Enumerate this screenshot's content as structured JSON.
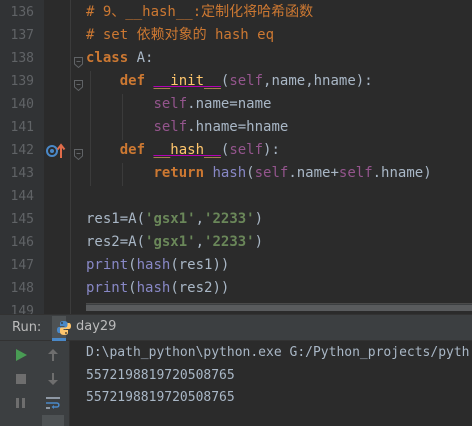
{
  "editor": {
    "lines": [
      {
        "num": "136",
        "tokens": [
          {
            "t": "# 9、__hash__:定制化将哈希函数",
            "c": "cmt"
          }
        ]
      },
      {
        "num": "137",
        "tokens": [
          {
            "t": "# set 依赖对象的 hash eq",
            "c": "cmt"
          }
        ]
      },
      {
        "num": "138",
        "tokens": [
          {
            "t": "class ",
            "c": "kw"
          },
          {
            "t": "A",
            "c": "pl"
          },
          {
            "t": ":",
            "c": "pl"
          }
        ]
      },
      {
        "num": "139",
        "tokens": [
          {
            "t": "    "
          },
          {
            "t": "def ",
            "c": "kw"
          },
          {
            "t": "__init__",
            "c": "dunder"
          },
          {
            "t": "(",
            "c": "pl"
          },
          {
            "t": "self",
            "c": "slf"
          },
          {
            "t": ",",
            "c": "pl"
          },
          {
            "t": "name",
            "c": "prm"
          },
          {
            "t": ",",
            "c": "pl"
          },
          {
            "t": "hname",
            "c": "prm"
          },
          {
            "t": "):",
            "c": "pl"
          }
        ]
      },
      {
        "num": "140",
        "tokens": [
          {
            "t": "        "
          },
          {
            "t": "self",
            "c": "slf"
          },
          {
            "t": ".name=name",
            "c": "pl"
          }
        ]
      },
      {
        "num": "141",
        "tokens": [
          {
            "t": "        "
          },
          {
            "t": "self",
            "c": "slf"
          },
          {
            "t": ".hname=hname",
            "c": "pl"
          }
        ]
      },
      {
        "num": "142",
        "tokens": [
          {
            "t": "    "
          },
          {
            "t": "def ",
            "c": "kw"
          },
          {
            "t": "__hash__",
            "c": "dunder"
          },
          {
            "t": "(",
            "c": "pl"
          },
          {
            "t": "self",
            "c": "slf"
          },
          {
            "t": "):",
            "c": "pl"
          }
        ]
      },
      {
        "num": "143",
        "tokens": [
          {
            "t": "        "
          },
          {
            "t": "return ",
            "c": "kw"
          },
          {
            "t": "hash",
            "c": "bi"
          },
          {
            "t": "(",
            "c": "pl"
          },
          {
            "t": "self",
            "c": "slf"
          },
          {
            "t": ".name+",
            "c": "pl"
          },
          {
            "t": "self",
            "c": "slf"
          },
          {
            "t": ".hname)",
            "c": "pl"
          }
        ]
      },
      {
        "num": "144",
        "tokens": []
      },
      {
        "num": "145",
        "tokens": [
          {
            "t": "res1=A(",
            "c": "pl"
          },
          {
            "t": "'gsx1'",
            "c": "str"
          },
          {
            "t": ",",
            "c": "pl"
          },
          {
            "t": "'2233'",
            "c": "str"
          },
          {
            "t": ")",
            "c": "pl"
          }
        ]
      },
      {
        "num": "146",
        "tokens": [
          {
            "t": "res2=A(",
            "c": "pl"
          },
          {
            "t": "'gsx1'",
            "c": "str"
          },
          {
            "t": ",",
            "c": "pl"
          },
          {
            "t": "'2233'",
            "c": "str"
          },
          {
            "t": ")",
            "c": "pl"
          }
        ]
      },
      {
        "num": "147",
        "tokens": [
          {
            "t": "print",
            "c": "bi"
          },
          {
            "t": "(",
            "c": "pl"
          },
          {
            "t": "hash",
            "c": "bi"
          },
          {
            "t": "(res1))",
            "c": "pl"
          }
        ]
      },
      {
        "num": "148",
        "tokens": [
          {
            "t": "print",
            "c": "bi"
          },
          {
            "t": "(",
            "c": "pl"
          },
          {
            "t": "hash",
            "c": "bi"
          },
          {
            "t": "(res2))",
            "c": "pl"
          }
        ]
      },
      {
        "num": "149",
        "tokens": []
      }
    ]
  },
  "run_panel": {
    "label": "Run:",
    "tab_label": "day29",
    "console_lines": [
      "D:\\path_python\\python.exe G:/Python_projects/pyth",
      "5572198819720508765",
      "5572198819720508765"
    ]
  },
  "icons": {
    "run_tab": "python-icon",
    "gutter": "override-method-icon",
    "tools": [
      "run-icon",
      "stop-icon",
      "pause-icon",
      "scroll-up-icon",
      "scroll-down-icon",
      "soft-wrap-icon"
    ]
  },
  "colors": {
    "background": "#2b2b2b",
    "keyword": "#cc7832",
    "string": "#6a8759",
    "function": "#ffc66d",
    "self": "#94558d",
    "builtin": "#8888c6",
    "run_green": "#499c54"
  }
}
